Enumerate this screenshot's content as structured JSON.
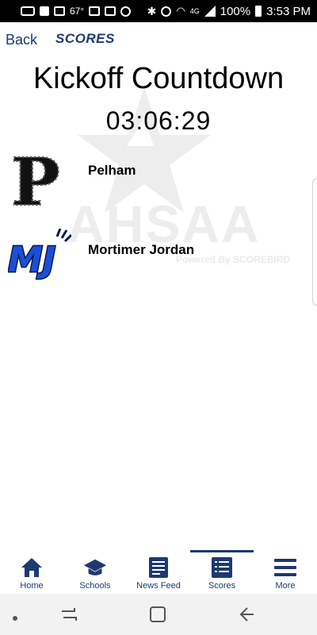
{
  "status_bar": {
    "temperature": "67°",
    "network": "4G",
    "battery": "100%",
    "time": "3:53 PM",
    "icons": [
      "message-icon",
      "facebook-icon",
      "image-icon",
      "mail-icon",
      "mail-icon",
      "sync-icon",
      "bluetooth-icon",
      "alarm-icon",
      "wifi-icon",
      "signal-icon",
      "battery-icon"
    ]
  },
  "header": {
    "back_label": "Back",
    "title": "SCORES"
  },
  "countdown": {
    "title": "Kickoff Countdown",
    "time": "03:06:29"
  },
  "watermark": {
    "text": "AHSAA",
    "powered": "Powered By SCOREBIRD"
  },
  "teams": [
    {
      "name": "Pelham",
      "logo_text": "P"
    },
    {
      "name": "Mortimer Jordan",
      "logo_text": "MJ"
    }
  ],
  "tabs": [
    {
      "label": "Home",
      "icon": "home-icon"
    },
    {
      "label": "Schools",
      "icon": "graduation-cap-icon"
    },
    {
      "label": "News Feed",
      "icon": "newspaper-icon"
    },
    {
      "label": "Scores",
      "icon": "scoreboard-icon",
      "active": true
    },
    {
      "label": "More",
      "icon": "menu-icon"
    }
  ],
  "colors": {
    "brand": "#1d3a70",
    "logo_blue": "#1a4fd6"
  }
}
